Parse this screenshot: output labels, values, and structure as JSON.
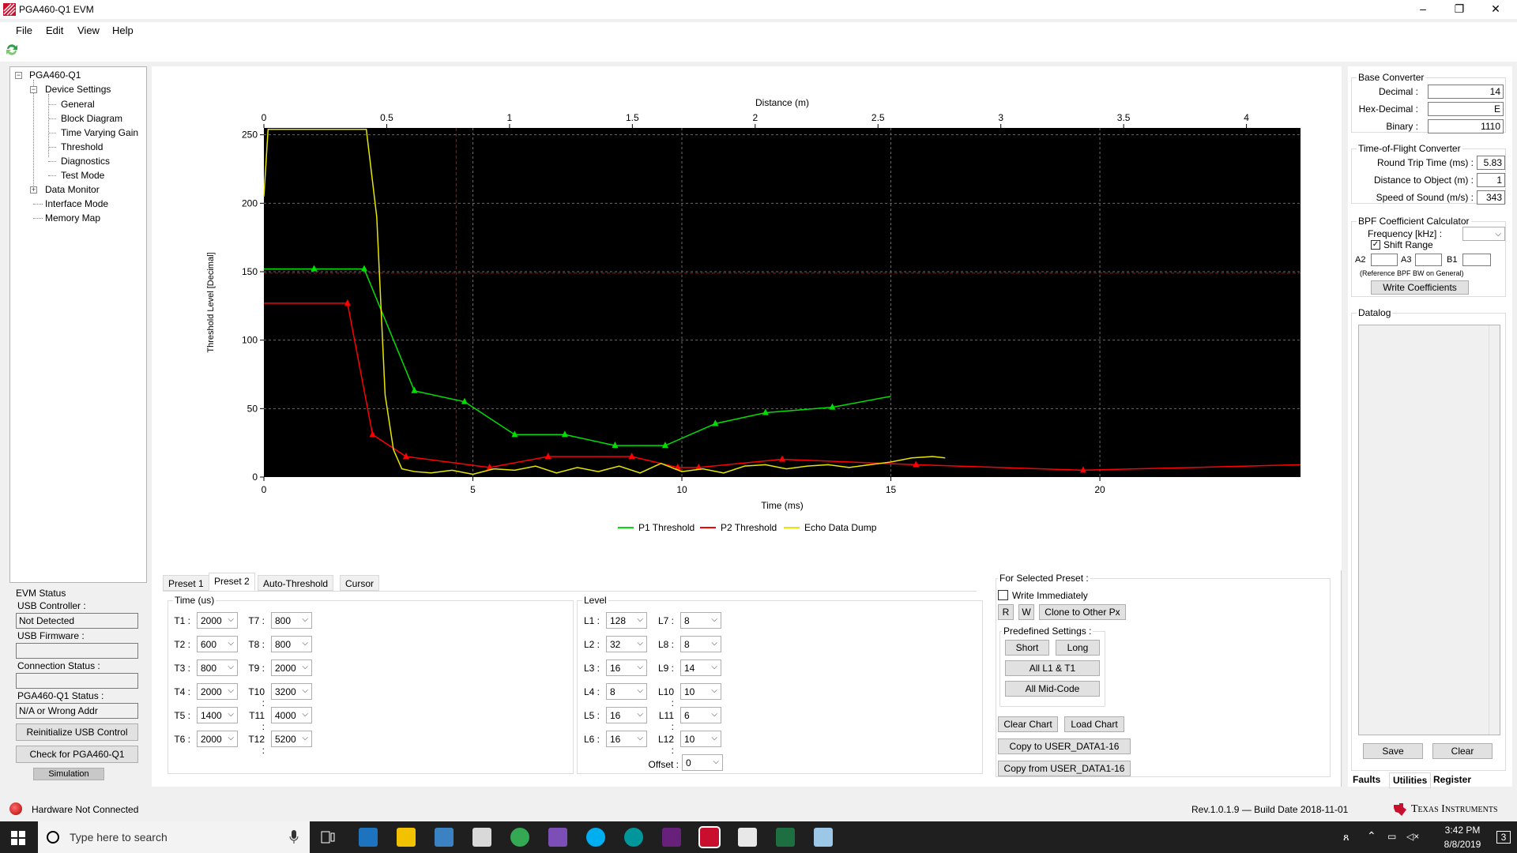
{
  "window": {
    "title": "PGA460-Q1 EVM",
    "minimize": "–",
    "maximize": "❐",
    "close": "✕"
  },
  "menu": [
    "File",
    "Edit",
    "View",
    "Help"
  ],
  "tree": {
    "root": "PGA460-Q1",
    "device_settings": "Device Settings",
    "children": [
      "General",
      "Block Diagram",
      "Time Varying Gain",
      "Threshold",
      "Diagnostics",
      "Test Mode"
    ],
    "data_monitor": "Data Monitor",
    "interface_mode": "Interface Mode",
    "memory_map": "Memory Map"
  },
  "evm_status": {
    "title": "EVM Status",
    "usb_controller_label": "USB Controller :",
    "usb_controller_value": "Not Detected",
    "usb_firmware_label": "USB Firmware :",
    "usb_firmware_value": "",
    "connection_label": "Connection Status :",
    "connection_value": "",
    "pga_status_label": "PGA460-Q1 Status :",
    "pga_status_value": "N/A or Wrong Addr",
    "reinit_button": "Reinitialize USB Control",
    "check_button": "Check for PGA460-Q1",
    "simulation_button": "Simulation"
  },
  "chart_data": {
    "type": "line",
    "top_axis_label": "Distance (m)",
    "xlabel": "Time (ms)",
    "ylabel": "Threshold Level [Decimal]",
    "xlim": [
      0,
      24.8
    ],
    "ylim": [
      0,
      255
    ],
    "x_ticks": [
      "0",
      "5",
      "10",
      "15",
      "20"
    ],
    "top_ticks": [
      "0",
      "0.5",
      "1",
      "1.5",
      "2",
      "2.5",
      "3",
      "3.5",
      "4"
    ],
    "top_tick_values": [
      0,
      0.5,
      1,
      1.5,
      2,
      2.5,
      3,
      3.5,
      4
    ],
    "top_axis_max": 4.22,
    "y_ticks": [
      "0",
      "50",
      "100",
      "150",
      "200",
      "250"
    ],
    "grid": true,
    "red_dashed_cursor_x": 4.6,
    "red_dashed_cursor_y": 149,
    "legend_position": "bottom-center",
    "series": [
      {
        "name": "P1 Threshold",
        "color": "#00e000",
        "x": [
          0,
          1.2,
          2.4,
          3.6,
          4.8,
          6.0,
          7.2,
          8.4,
          9.6,
          10.8,
          12.0,
          13.6,
          15.0
        ],
        "y": [
          152,
          152,
          152,
          63,
          55,
          31,
          31,
          23,
          23,
          39,
          47,
          51,
          59
        ],
        "marker_x": [
          1.2,
          2.4,
          3.6,
          4.8,
          6.0,
          7.2,
          8.4,
          9.6,
          10.8,
          12.0,
          13.6
        ]
      },
      {
        "name": "P2 Threshold",
        "color": "#ff0000",
        "x": [
          0,
          2.0,
          2.6,
          3.4,
          5.4,
          6.8,
          8.8,
          9.9,
          10.4,
          12.4,
          15.6,
          19.6,
          24.8
        ],
        "y": [
          127,
          127,
          31,
          15,
          7,
          15,
          15,
          7,
          7,
          13,
          9,
          5,
          9
        ],
        "marker_x": [
          2.0,
          2.6,
          3.4,
          5.4,
          6.8,
          8.8,
          9.9,
          10.4,
          12.4,
          15.6,
          19.6
        ]
      },
      {
        "name": "Echo Data Dump",
        "color": "#e6e600",
        "x": [
          0,
          0.1,
          2.45,
          2.7,
          2.9,
          3.1,
          3.3,
          3.6,
          4.0,
          4.5,
          5.0,
          5.5,
          6.0,
          6.5,
          7.0,
          7.5,
          8.0,
          8.5,
          9.0,
          9.5,
          10.0,
          10.5,
          11.0,
          11.5,
          12.0,
          12.5,
          13.0,
          13.5,
          14.0,
          14.5,
          15.0,
          15.5,
          16.0,
          16.3
        ],
        "y": [
          205,
          254,
          254,
          190,
          60,
          20,
          6,
          4,
          3,
          5,
          2,
          6,
          5,
          8,
          3,
          7,
          4,
          8,
          3,
          10,
          4,
          6,
          3,
          8,
          9,
          6,
          8,
          9,
          7,
          9,
          11,
          14,
          15,
          14
        ]
      }
    ]
  },
  "tabs": [
    "Preset 1",
    "Preset 2",
    "Auto-Threshold",
    "Cursor"
  ],
  "time_group": {
    "title": "Time (us)",
    "left": [
      [
        "T1 :",
        "2000"
      ],
      [
        "T2 :",
        "600"
      ],
      [
        "T3 :",
        "800"
      ],
      [
        "T4 :",
        "2000"
      ],
      [
        "T5 :",
        "1400"
      ],
      [
        "T6 :",
        "2000"
      ]
    ],
    "right": [
      [
        "T7 :",
        "800"
      ],
      [
        "T8 :",
        "800"
      ],
      [
        "T9 :",
        "2000"
      ],
      [
        "T10 :",
        "3200"
      ],
      [
        "T11 :",
        "4000"
      ],
      [
        "T12 :",
        "5200"
      ]
    ]
  },
  "level_group": {
    "title": "Level",
    "left": [
      [
        "L1 :",
        "128"
      ],
      [
        "L2 :",
        "32"
      ],
      [
        "L3 :",
        "16"
      ],
      [
        "L4 :",
        "8"
      ],
      [
        "L5 :",
        "16"
      ],
      [
        "L6 :",
        "16"
      ]
    ],
    "right": [
      [
        "L7 :",
        "8"
      ],
      [
        "L8 :",
        "8"
      ],
      [
        "L9 :",
        "14"
      ],
      [
        "L10 :",
        "10"
      ],
      [
        "L11 :",
        "6"
      ],
      [
        "L12 :",
        "10"
      ]
    ],
    "offset_label": "Offset :",
    "offset_value": "0"
  },
  "preset_actions": {
    "title": "For Selected Preset :",
    "write_immediately": "Write Immediately",
    "r": "R",
    "w": "W",
    "clone": "Clone to Other Px",
    "predefined_title": "Predefined Settings :",
    "short": "Short",
    "long": "Long",
    "all_l1_t1": "All L1 & T1",
    "all_mid": "All Mid-Code",
    "clear_chart": "Clear Chart",
    "load_chart": "Load Chart",
    "copy_to": "Copy to USER_DATA1-16",
    "copy_from": "Copy from USER_DATA1-16"
  },
  "base_converter": {
    "title": "Base Converter",
    "decimal_label": "Decimal :",
    "decimal_value": "14",
    "hex_label": "Hex-Decimal :",
    "hex_value": "E",
    "binary_label": "Binary :",
    "binary_value": "1110"
  },
  "tof_converter": {
    "title": "Time-of-Flight Converter",
    "rtt_label": "Round Trip Time (ms) :",
    "rtt_value": "5.83",
    "dist_label": "Distance to Object (m) :",
    "dist_value": "1",
    "sos_label": "Speed of Sound (m/s) :",
    "sos_value": "343"
  },
  "bpf": {
    "title": "BPF Coefficient Calculator",
    "freq_label": "Frequency [kHz] :",
    "shift_range": "Shift Range",
    "a2": "A2",
    "a3": "A3",
    "b1": "B1",
    "note": "(Reference BPF BW on General)",
    "write_button": "Write Coefficients"
  },
  "datalog": {
    "title": "Datalog",
    "save": "Save",
    "clear": "Clear"
  },
  "right_tabs": [
    "Faults",
    "Utilities",
    "Register"
  ],
  "status": {
    "hardware": "Hardware Not Connected",
    "revision": "Rev.1.0.1.9 — Build Date 2018-11-01",
    "brand": "Texas Instruments"
  },
  "taskbar": {
    "search_placeholder": "Type here to search",
    "time": "3:42 PM",
    "date": "8/8/2019",
    "notifications": "3"
  }
}
